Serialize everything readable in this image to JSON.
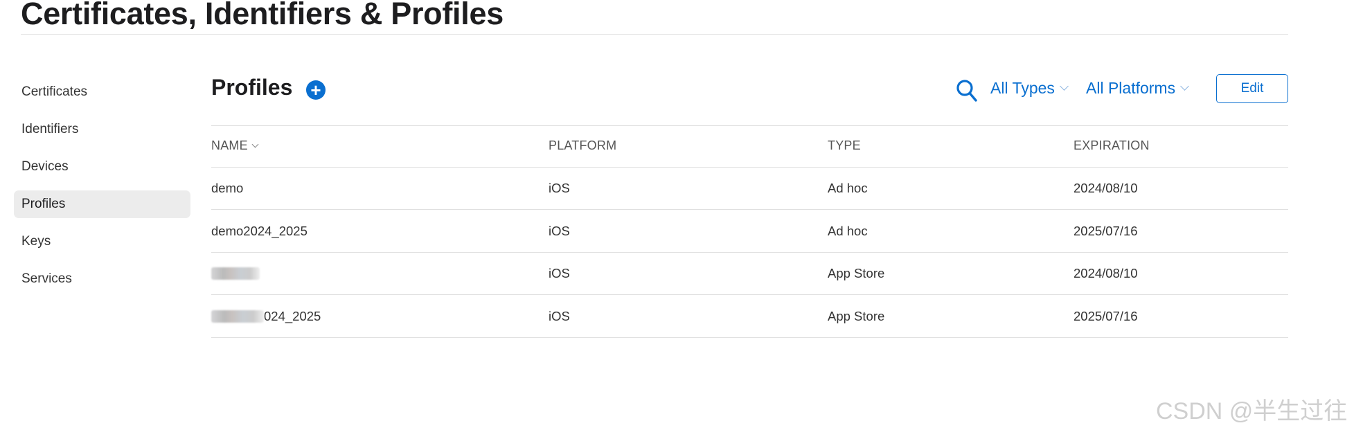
{
  "page_title": "Certificates, Identifiers & Profiles",
  "sidebar": {
    "items": [
      {
        "label": "Certificates",
        "active": false
      },
      {
        "label": "Identifiers",
        "active": false
      },
      {
        "label": "Devices",
        "active": false
      },
      {
        "label": "Profiles",
        "active": true
      },
      {
        "label": "Keys",
        "active": false
      },
      {
        "label": "Services",
        "active": false
      }
    ]
  },
  "main": {
    "heading": "Profiles",
    "add_icon": "plus-circle-icon",
    "add_symbol": "+",
    "search_icon": "search-icon",
    "filters": {
      "type": "All Types",
      "platform": "All Platforms"
    },
    "edit_label": "Edit",
    "accent_color": "#0a6fd0"
  },
  "table": {
    "columns": [
      "NAME",
      "PLATFORM",
      "TYPE",
      "EXPIRATION"
    ],
    "sort_column": "NAME",
    "rows": [
      {
        "name": "demo",
        "name_redacted": false,
        "platform": "iOS",
        "type": "Ad hoc",
        "expiration": "2024/08/10"
      },
      {
        "name": "demo2024_2025",
        "name_redacted": false,
        "platform": "iOS",
        "type": "Ad hoc",
        "expiration": "2025/07/16"
      },
      {
        "name": "",
        "name_redacted": true,
        "platform": "iOS",
        "type": "App Store",
        "expiration": "2024/08/10"
      },
      {
        "name": "024_2025",
        "name_redacted": true,
        "platform": "iOS",
        "type": "App Store",
        "expiration": "2025/07/16"
      }
    ]
  },
  "watermark": "CSDN @半生过往"
}
